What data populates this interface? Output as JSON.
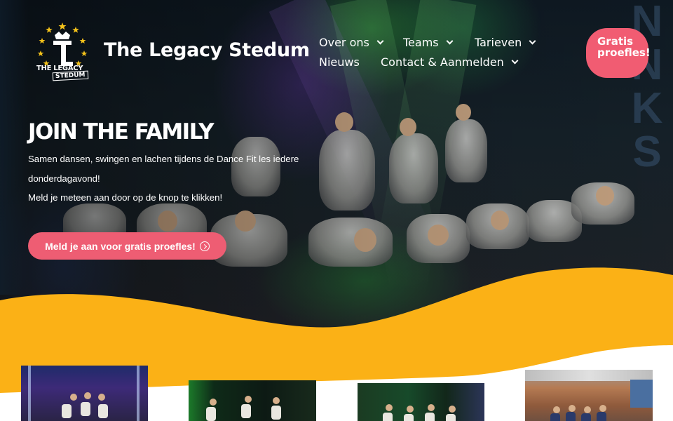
{
  "site": {
    "title": "The Legacy Stedum",
    "logo_text_top": "THE LEGACY",
    "logo_text_bottom": "STEDUM",
    "logo_monogram": "TL"
  },
  "nav": {
    "items": [
      {
        "label": "Over ons",
        "has_dropdown": true
      },
      {
        "label": "Teams",
        "has_dropdown": true
      },
      {
        "label": "Tarieven",
        "has_dropdown": true
      },
      {
        "label": "Nieuws",
        "has_dropdown": false
      },
      {
        "label": "Contact & Aanmelden",
        "has_dropdown": true
      }
    ],
    "cta_label": "Gratis proefles!"
  },
  "hero": {
    "heading": "JOIN THE FAMILY",
    "line1": "Samen dansen, swingen en lachen tijdens de Dance Fit les iedere",
    "line2": "donderdagavond!",
    "line3": "Meld je meteen aan door op de knop te klikken!",
    "button_label": "Meld je aan voor gratis proefles!",
    "button_icon": "circle-arrow-right-icon",
    "curtain_letters": [
      "N",
      "N",
      "K",
      "S"
    ]
  },
  "colors": {
    "accent": "#f15c72",
    "wave": "#fbb116",
    "text_on_dark": "#ffffff"
  },
  "gallery": {
    "thumbnails": [
      "stage-group-photo",
      "stage-performance-photo",
      "stage-dance-photo",
      "gym-group-photo"
    ]
  }
}
